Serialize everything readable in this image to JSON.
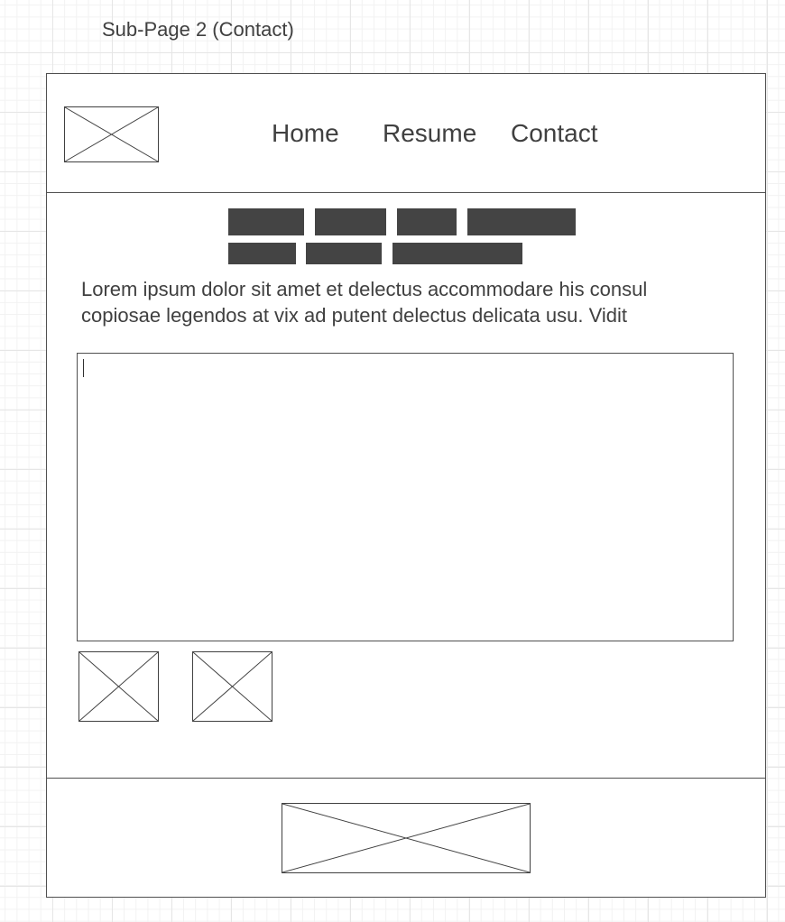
{
  "page": {
    "title": "Sub-Page 2 (Contact)"
  },
  "header": {
    "logo_icon": "image-placeholder-icon",
    "nav": [
      {
        "label": "Home"
      },
      {
        "label": "Resume"
      },
      {
        "label": "Contact"
      }
    ]
  },
  "content": {
    "tag_rows": [
      {
        "tags": 4
      },
      {
        "tags": 3
      }
    ],
    "intro_text": "Lorem ipsum dolor sit amet et delectus accommodare his consul copiosae legendos at vix ad putent delectus delicata usu. Vidit",
    "message_box": {
      "value": "",
      "has_caret": true
    },
    "thumbnails": [
      {
        "icon": "image-placeholder-icon"
      },
      {
        "icon": "image-placeholder-icon"
      }
    ]
  },
  "footer": {
    "banner_icon": "image-placeholder-icon"
  },
  "colors": {
    "tag_fill": "#444444",
    "text": "#404040",
    "line": "#505050",
    "grid": "#e6e6e6"
  }
}
